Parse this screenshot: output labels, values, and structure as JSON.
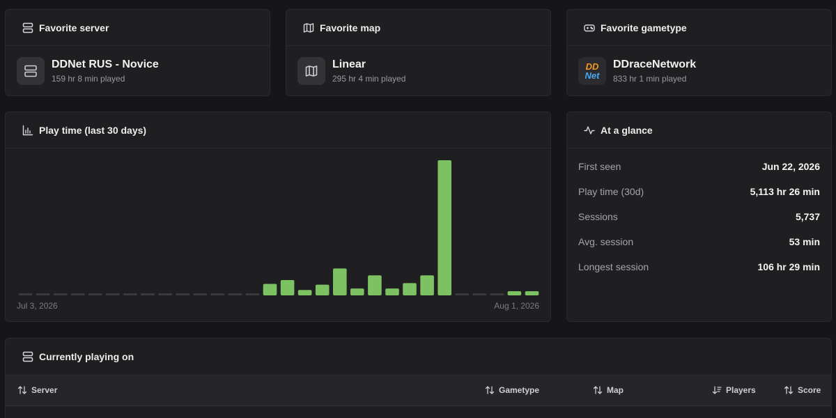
{
  "favorites": {
    "server": {
      "heading": "Favorite server",
      "name": "DDNet RUS - Novice",
      "played": "159 hr 8 min played"
    },
    "map": {
      "heading": "Favorite map",
      "name": "Linear",
      "played": "295 hr 4 min played"
    },
    "gametype": {
      "heading": "Favorite gametype",
      "name": "DDraceNetwork",
      "played": "833 hr 1 min played",
      "logo_text": [
        "DD",
        "Net"
      ]
    }
  },
  "playtime": {
    "heading": "Play time (last 30 days)",
    "x_start": "Jul 3, 2026",
    "x_end": "Aug 1, 2026"
  },
  "chart_data": {
    "type": "bar",
    "title": "Play time (last 30 days)",
    "x_range": [
      "Jul 3, 2026",
      "Aug 1, 2026"
    ],
    "values": [
      0,
      0,
      0,
      0,
      0,
      0,
      0,
      0,
      0,
      0,
      0,
      0,
      0,
      0,
      1.5,
      2.0,
      0.7,
      1.4,
      3.5,
      0.9,
      2.6,
      0.9,
      1.6,
      2.6,
      17.6,
      0,
      0,
      0,
      0.5,
      0.5
    ],
    "y_max": 17.6,
    "bar_color": "#7cc262",
    "empty_color": "#3b3b3e"
  },
  "glance": {
    "heading": "At a glance",
    "rows": [
      {
        "label": "First seen",
        "value": "Jun 22, 2026"
      },
      {
        "label": "Play time (30d)",
        "value": "5,113 hr 26 min"
      },
      {
        "label": "Sessions",
        "value": "5,737"
      },
      {
        "label": "Avg. session",
        "value": "53 min"
      },
      {
        "label": "Longest session",
        "value": "106 hr 29 min"
      }
    ]
  },
  "current": {
    "heading": "Currently playing on",
    "columns": {
      "server": "Server",
      "gametype": "Gametype",
      "map": "Map",
      "players": "Players",
      "score": "Score"
    }
  },
  "colors": {
    "accent": "#7cc262",
    "background": "#161618",
    "card": "#1f1f21"
  },
  "icons": {
    "server": "server-icon",
    "map": "map-icon",
    "gametype": "gamepad-icon",
    "chart": "bar-chart-icon",
    "glance": "activity-icon",
    "sort": "sort-arrows-icon"
  }
}
